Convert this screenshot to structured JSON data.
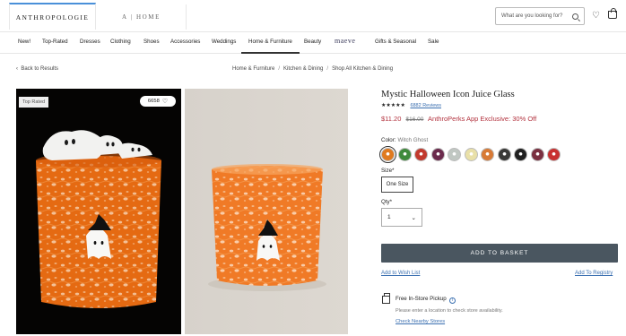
{
  "header": {
    "brand": "ANTHROPOLOGIE",
    "brand2": "A  |  HOME",
    "search_placeholder": "What are you looking for?"
  },
  "nav": [
    "New!",
    "Top-Rated",
    "Dresses",
    "Clothing",
    "Shoes",
    "Accessories",
    "Weddings",
    "Home & Furniture",
    "Beauty",
    "maeve",
    "Gifts & Seasonal",
    "Sale"
  ],
  "breadcrumb": {
    "back": "Back to Results",
    "items": [
      "Home & Furniture",
      "Kitchen & Dining",
      "Shop All Kitchen & Dining"
    ]
  },
  "gallery": {
    "badge": "Top Rated",
    "likes": "6658"
  },
  "product": {
    "title": "Mystic Halloween Icon Juice Glass",
    "stars": "★★★★★",
    "reviews": "6882 Reviews",
    "price_sale": "$11.20",
    "price_orig": "$16.00",
    "promo": "AnthroPerks App Exclusive: 30% Off",
    "color_label": "Color:",
    "color_value": "Witch Ghost",
    "swatches": [
      "#e07a1f",
      "#3f8a3c",
      "#c23a2e",
      "#6b2a4c",
      "#c0c7c2",
      "#e9e0a8",
      "#d87a35",
      "#3a3a38",
      "#202020",
      "#7a3040",
      "#c83030"
    ],
    "size_label": "Size*",
    "size_value": "One Size",
    "qty_label": "Qty*",
    "qty_value": "1",
    "add_to_basket": "ADD TO BASKET",
    "wishlist": "Add to Wish List",
    "registry": "Add To Registry",
    "pickup_title": "Free In-Store Pickup",
    "pickup_note": "Please enter a location to check store availability.",
    "nearby": "Check Nearby Stores"
  }
}
